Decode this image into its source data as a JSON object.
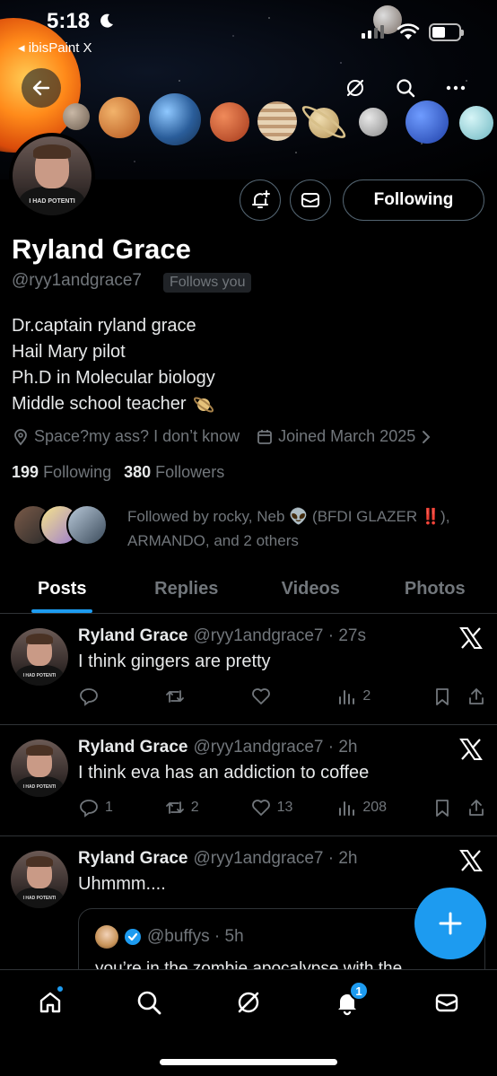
{
  "status_bar": {
    "time": "5:18",
    "back_app": "◂ ibisPaint X"
  },
  "profile": {
    "name": "Ryland Grace",
    "handle": "@ryy1andgrace7",
    "follows_you": "Follows you",
    "following_button": "Following",
    "bio_lines": [
      "Dr.captain ryland grace",
      "Hail Mary pilot",
      "Ph.D in Molecular biology",
      "Middle school teacher"
    ],
    "location": "Space?my ass? I don’t know",
    "joined": "Joined March 2025",
    "following_count": "199",
    "following_label": "Following",
    "followers_count": "380",
    "followers_label": "Followers",
    "followed_by": "Followed by rocky, Neb 👽 (BFDI GLAZER ‼️), ARMANDO, and 2 others",
    "avatar_shirt_text": "I HAD POTENTI"
  },
  "tabs": [
    "Posts",
    "Replies",
    "Videos",
    "Photos"
  ],
  "posts": [
    {
      "name": "Ryland Grace",
      "meta": "@ryy1andgrace7 · 27s",
      "text": "I think gingers are pretty",
      "replies": "",
      "reposts": "",
      "likes": "",
      "views": "2"
    },
    {
      "name": "Ryland Grace",
      "meta": "@ryy1andgrace7 · 2h",
      "text": "I think eva has an addiction to coffee",
      "replies": "1",
      "reposts": "2",
      "likes": "13",
      "views": "208"
    },
    {
      "name": "Ryland Grace",
      "meta": "@ryy1andgrace7 · 2h",
      "text": "Uhmmm....",
      "quote": {
        "meta": "@buffys · 5h",
        "text": "you’re in the zombie apocalypse with the"
      }
    }
  ],
  "nav": {
    "notification_badge": "1"
  },
  "colors": {
    "accent": "#1d9bf0",
    "background": "#000000",
    "muted": "#71767b",
    "border": "#2f3336"
  }
}
